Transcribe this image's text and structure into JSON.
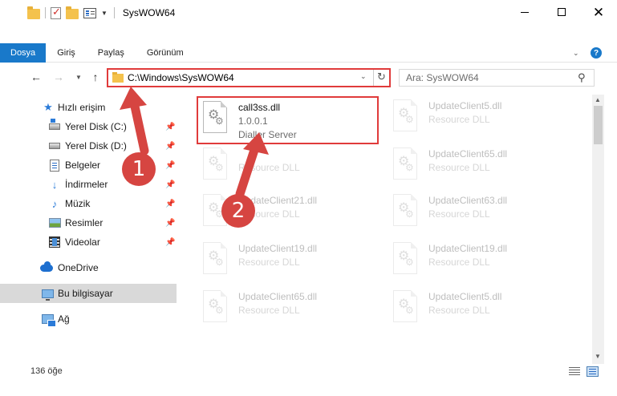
{
  "window": {
    "title": "SysWOW64"
  },
  "ribbon": {
    "tabs": [
      "Dosya",
      "Giriş",
      "Paylaş",
      "Görünüm"
    ],
    "help": "?"
  },
  "address": {
    "path": "C:\\Windows\\SysWOW64",
    "search_placeholder": "Ara: SysWOW64"
  },
  "sidebar": {
    "quick_access": "Hızlı erişim",
    "items": [
      {
        "label": "Yerel Disk (C:)",
        "icon": "local-disk-c-icon"
      },
      {
        "label": "Yerel Disk (D:)",
        "icon": "local-disk-d-icon"
      },
      {
        "label": "Belgeler",
        "icon": "documents-icon"
      },
      {
        "label": "İndirmeler",
        "icon": "downloads-icon"
      },
      {
        "label": "Müzik",
        "icon": "music-icon"
      },
      {
        "label": "Resimler",
        "icon": "pictures-icon"
      },
      {
        "label": "Videolar",
        "icon": "videos-icon"
      }
    ],
    "onedrive": "OneDrive",
    "this_pc": "Bu bilgisayar",
    "network": "Ağ"
  },
  "files": {
    "selected": {
      "name": "call3ss.dll",
      "version": "1.0.0.1",
      "description": "Dialler Server"
    },
    "left": [
      {
        "name": "",
        "sub": "Resource DLL"
      },
      {
        "name": "UpdateClient21.dll",
        "sub": "Resource DLL"
      },
      {
        "name": "UpdateClient19.dll",
        "sub": "Resource DLL"
      },
      {
        "name": "UpdateClient65.dll",
        "sub": "Resource DLL"
      }
    ],
    "right": [
      {
        "name": "UpdateClient5.dll",
        "sub": "Resource DLL"
      },
      {
        "name": "UpdateClient65.dll",
        "sub": "Resource DLL"
      },
      {
        "name": "UpdateClient63.dll",
        "sub": "Resource DLL"
      },
      {
        "name": "UpdateClient19.dll",
        "sub": "Resource DLL"
      },
      {
        "name": "UpdateClient5.dll",
        "sub": "Resource DLL"
      }
    ]
  },
  "status": {
    "count": "136 öğe"
  },
  "annotations": {
    "step1": "1",
    "step2": "2",
    "color": "#d64541"
  },
  "colors": {
    "accent": "#1979ca",
    "highlight": "#e03b3b"
  }
}
